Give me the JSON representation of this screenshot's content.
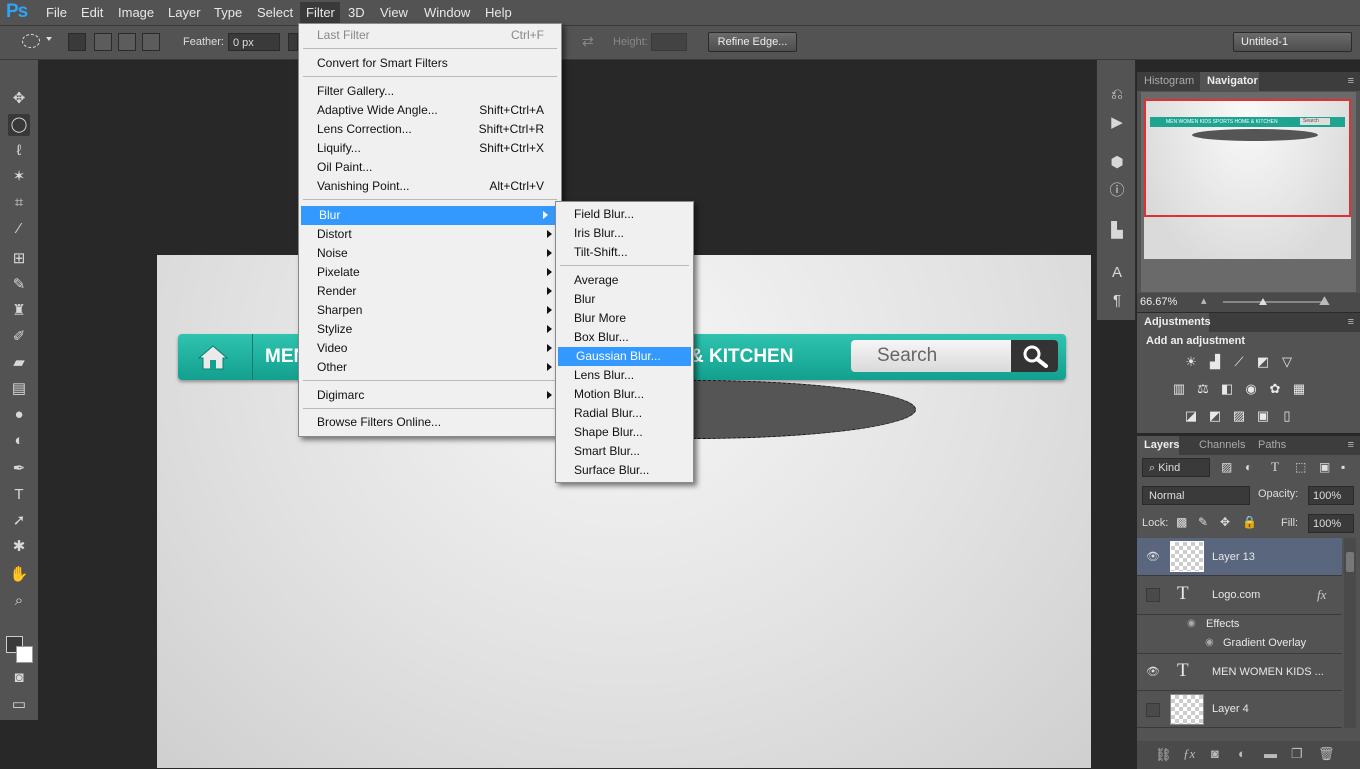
{
  "app": {
    "logo": "Ps"
  },
  "menubar": {
    "items": [
      "File",
      "Edit",
      "Image",
      "Layer",
      "Type",
      "Select",
      "Filter",
      "3D",
      "View",
      "Window",
      "Help"
    ]
  },
  "options": {
    "feather_label": "Feather:",
    "feather_value": "0 px",
    "height_label": "Height:",
    "refine_edge": "Refine Edge...",
    "preset": "Untitled-1"
  },
  "filter_menu": {
    "items": [
      {
        "label": "Last Filter",
        "shortcut": "Ctrl+F"
      },
      {
        "label": "Convert for Smart Filters"
      },
      {
        "label": "Filter Gallery..."
      },
      {
        "label": "Adaptive Wide Angle...",
        "shortcut": "Shift+Ctrl+A"
      },
      {
        "label": "Lens Correction...",
        "shortcut": "Shift+Ctrl+R"
      },
      {
        "label": "Liquify...",
        "shortcut": "Shift+Ctrl+X"
      },
      {
        "label": "Oil Paint..."
      },
      {
        "label": "Vanishing Point...",
        "shortcut": "Alt+Ctrl+V"
      },
      {
        "label": "Blur"
      },
      {
        "label": "Distort"
      },
      {
        "label": "Noise"
      },
      {
        "label": "Pixelate"
      },
      {
        "label": "Render"
      },
      {
        "label": "Sharpen"
      },
      {
        "label": "Stylize"
      },
      {
        "label": "Video"
      },
      {
        "label": "Other"
      },
      {
        "label": "Digimarc"
      },
      {
        "label": "Browse Filters Online..."
      }
    ]
  },
  "blur_menu": {
    "items": [
      "Field Blur...",
      "Iris Blur...",
      "Tilt-Shift...",
      "Average",
      "Blur",
      "Blur More",
      "Box Blur...",
      "Gaussian Blur...",
      "Lens Blur...",
      "Motion Blur...",
      "Radial Blur...",
      "Shape Blur...",
      "Smart Blur...",
      "Surface Blur..."
    ]
  },
  "canvas": {
    "nav_left": "MEN",
    "nav_right": "& KITCHEN",
    "search_placeholder": "Search"
  },
  "navigator": {
    "tabs": [
      "Histogram",
      "Navigator"
    ],
    "zoom": "66.67%",
    "mini_nav": "MEN   WOMEN   KIDS   SPORTS   HOME & KITCHEN",
    "mini_search": "Search"
  },
  "adjustments": {
    "tab": "Adjustments",
    "title": "Add an adjustment"
  },
  "layers_panel": {
    "tabs": [
      "Layers",
      "Channels",
      "Paths"
    ],
    "filter": "Kind",
    "blend_mode": "Normal",
    "opacity_label": "Opacity:",
    "opacity_value": "100%",
    "lock_label": "Lock:",
    "fill_label": "Fill:",
    "fill_value": "100%",
    "layers": [
      {
        "name": "Layer 13"
      },
      {
        "name": "Logo.com",
        "fx": "fx"
      },
      {
        "name": "Effects"
      },
      {
        "name": "Gradient Overlay"
      },
      {
        "name": "MEN   WOMEN   KIDS   ..."
      },
      {
        "name": "Layer 4"
      }
    ]
  },
  "colors": {
    "accent": "#3399ff",
    "brand_teal": "#1ea592",
    "selection_red": "#e03030"
  }
}
